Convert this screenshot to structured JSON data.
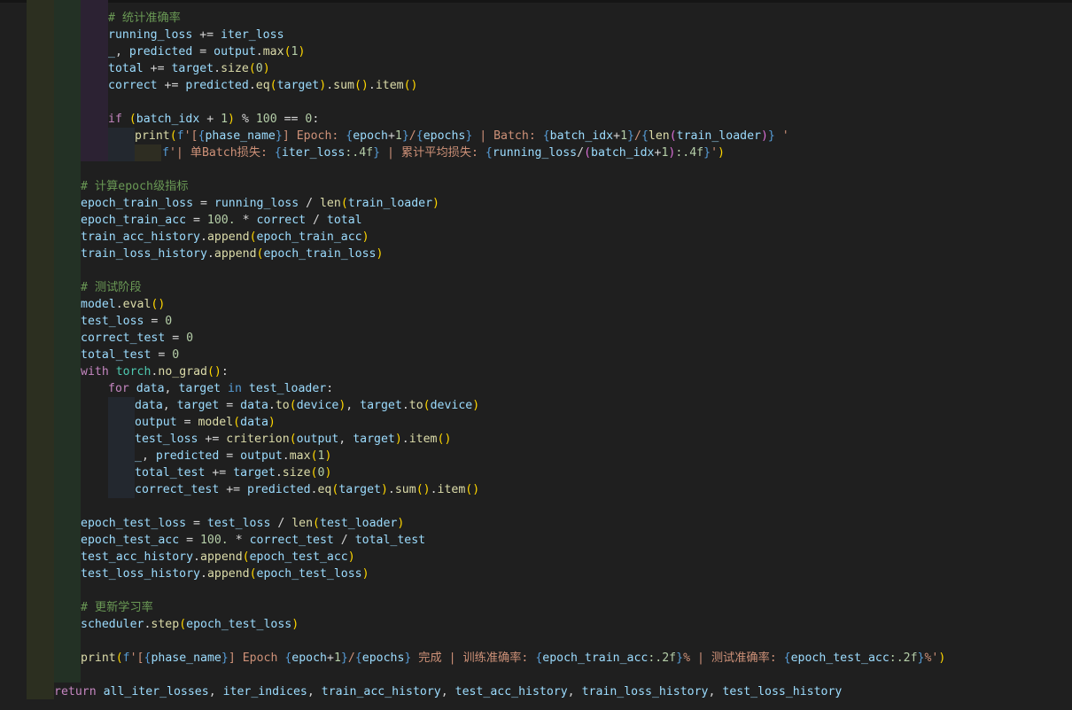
{
  "editor": {
    "language": "python",
    "colors": {
      "background": "#1f1f1f",
      "comment": "#6a9955",
      "variable": "#9cdcfe",
      "function": "#dcdcaa",
      "keyword": "#c586c0",
      "number": "#b5cea8",
      "string": "#ce9178"
    },
    "lines": [
      "# 统计准确率",
      "running_loss += iter_loss",
      "_, predicted = output.max(1)",
      "total += target.size(0)",
      "correct += predicted.eq(target).sum().item()",
      "",
      "if (batch_idx + 1) % 100 == 0:",
      "print(f'[{phase_name}] Epoch: {epoch+1}/{epochs} | Batch: {batch_idx+1}/{len(train_loader)} '",
      "f'| 单Batch损失: {iter_loss:.4f} | 累计平均损失: {running_loss/(batch_idx+1):.4f}')",
      "",
      "# 计算epoch级指标",
      "epoch_train_loss = running_loss / len(train_loader)",
      "epoch_train_acc = 100. * correct / total",
      "train_acc_history.append(epoch_train_acc)",
      "train_loss_history.append(epoch_train_loss)",
      "",
      "# 测试阶段",
      "model.eval()",
      "test_loss = 0",
      "correct_test = 0",
      "total_test = 0",
      "with torch.no_grad():",
      "for data, target in test_loader:",
      "data, target = data.to(device), target.to(device)",
      "output = model(data)",
      "test_loss += criterion(output, target).item()",
      "_, predicted = output.max(1)",
      "total_test += target.size(0)",
      "correct_test += predicted.eq(target).sum().item()",
      "",
      "epoch_test_loss = test_loss / len(test_loader)",
      "epoch_test_acc = 100. * correct_test / total_test",
      "test_acc_history.append(epoch_test_acc)",
      "test_loss_history.append(epoch_test_loss)",
      "",
      "# 更新学习率",
      "scheduler.step(epoch_test_loss)",
      "",
      "print(f'[{phase_name}] Epoch {epoch+1}/{epochs} 完成 | 训练准确率: {epoch_train_acc:.2f}% | 测试准确率: {epoch_test_acc:.2f}%')",
      "",
      "return all_iter_losses, iter_indices, train_acc_history, test_acc_history, train_loss_history, test_loss_history"
    ]
  }
}
